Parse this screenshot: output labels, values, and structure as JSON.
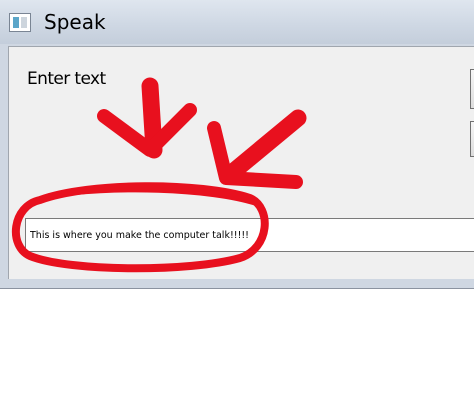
{
  "window": {
    "title": "Speak",
    "icon": "app-icon"
  },
  "form": {
    "label": "Enter text",
    "input_value": "This is where you make the computer talk!!!!!"
  },
  "annotation": {
    "color": "#e8101e"
  }
}
